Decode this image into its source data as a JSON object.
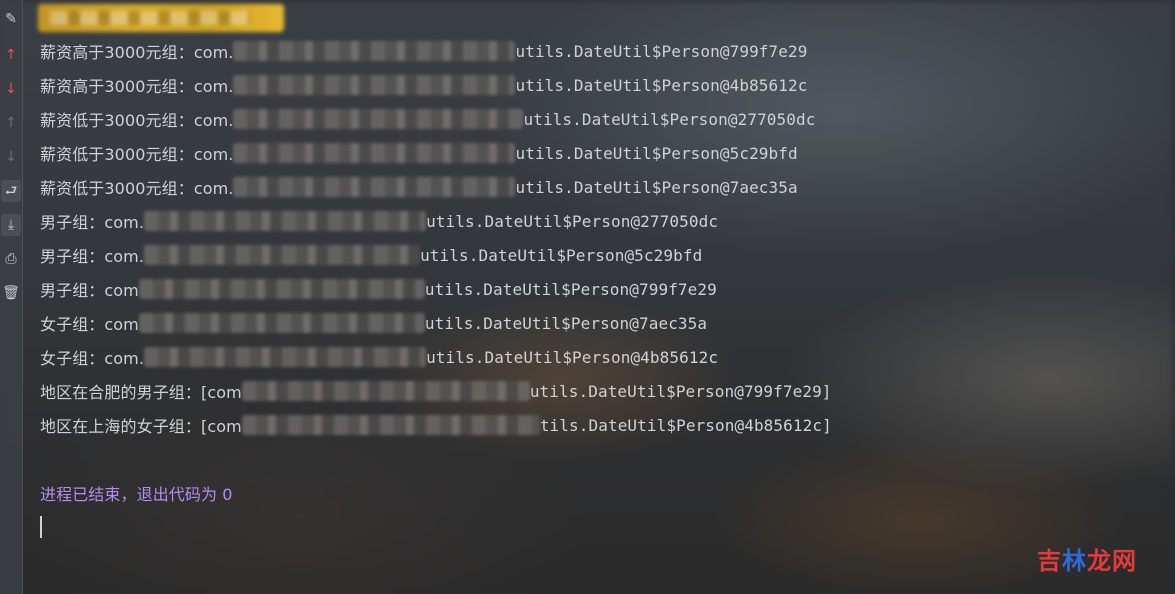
{
  "header": {
    "redacted": true
  },
  "gutter": {
    "icons": [
      "edit-icon",
      "arrow-up-icon",
      "arrow-down-icon",
      "arrow-up-disabled-icon",
      "arrow-down-disabled-icon",
      "soft-wrap-icon",
      "scroll-to-end-icon",
      "print-icon",
      "trash-icon"
    ]
  },
  "console": {
    "lines": [
      {
        "prefix": "薪资高于3000元组：com.",
        "suffix": "utils.DateUtil$Person@799f7e29"
      },
      {
        "prefix": "薪资高于3000元组：com.",
        "suffix": "utils.DateUtil$Person@4b85612c"
      },
      {
        "prefix": "薪资低于3000元组：com.",
        "suffix": "utils.DateUtil$Person@277050dc"
      },
      {
        "prefix": "薪资低于3000元组：com.",
        "suffix": "utils.DateUtil$Person@5c29bfd"
      },
      {
        "prefix": "薪资低于3000元组：com.",
        "suffix": "utils.DateUtil$Person@7aec35a"
      },
      {
        "prefix": "男子组：com.",
        "suffix": "utils.DateUtil$Person@277050dc"
      },
      {
        "prefix": "男子组：com.",
        "suffix": "utils.DateUtil$Person@5c29bfd"
      },
      {
        "prefix": "男子组：com",
        "suffix": "utils.DateUtil$Person@799f7e29"
      },
      {
        "prefix": "女子组：com",
        "suffix": "utils.DateUtil$Person@7aec35a"
      },
      {
        "prefix": "女子组：com.",
        "suffix": "utils.DateUtil$Person@4b85612c"
      },
      {
        "prefix": "地区在合肥的男子组：[com",
        "suffix": "utils.DateUtil$Person@799f7e29]"
      },
      {
        "prefix": "地区在上海的女子组：[com",
        "suffix": "tils.DateUtil$Person@4b85612c]"
      }
    ],
    "exit_message": "进程已结束，退出代码为 0"
  },
  "watermark": {
    "part1": "吉",
    "part2": "林",
    "part3": "龙网"
  }
}
